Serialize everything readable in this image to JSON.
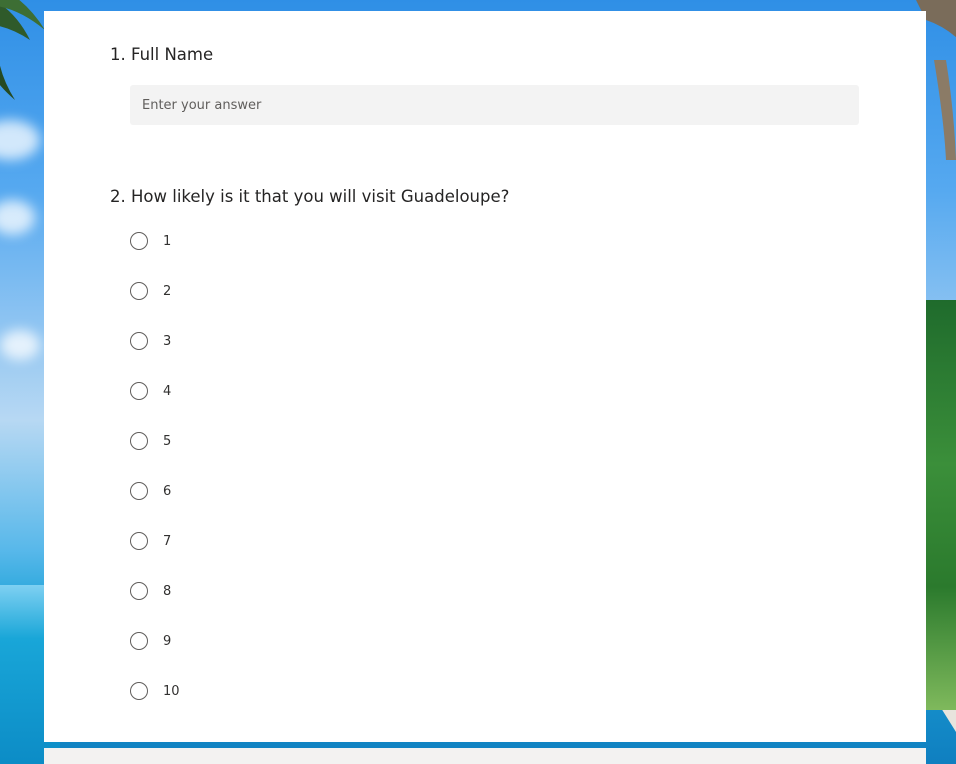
{
  "form": {
    "questions": [
      {
        "title": "1. Full Name",
        "type": "text",
        "placeholder": "Enter your answer",
        "value": ""
      },
      {
        "title": "2. How likely is it that you will visit Guadeloupe?",
        "type": "choice",
        "options": [
          "1",
          "2",
          "3",
          "4",
          "5",
          "6",
          "7",
          "8",
          "9",
          "10"
        ],
        "selected": null
      }
    ]
  },
  "colors": {
    "card": "#ffffff",
    "input_bg": "#f3f3f3",
    "radio_border": "#605e5c",
    "text": "#252424"
  }
}
